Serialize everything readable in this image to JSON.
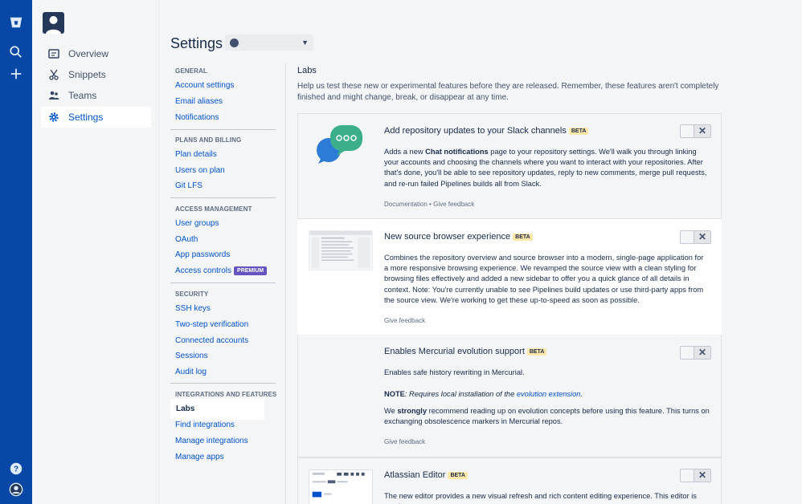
{
  "global_nav": {
    "icons": [
      "bitbucket-logo-icon",
      "search-icon",
      "plus-icon",
      "help-icon",
      "user-avatar-icon"
    ]
  },
  "container_nav": {
    "items": [
      {
        "label": "Overview",
        "icon": "overview-icon"
      },
      {
        "label": "Snippets",
        "icon": "scissors-icon"
      },
      {
        "label": "Teams",
        "icon": "people-icon"
      },
      {
        "label": "Settings",
        "icon": "gear-icon",
        "active": true
      }
    ]
  },
  "header": {
    "title": "Settings",
    "account_select": ""
  },
  "settings_nav": {
    "general": {
      "heading": "GENERAL",
      "links": [
        "Account settings",
        "Email aliases",
        "Notifications"
      ]
    },
    "plans": {
      "heading": "PLANS AND BILLING",
      "links": [
        "Plan details",
        "Users on plan",
        "Git LFS"
      ]
    },
    "access": {
      "heading": "ACCESS MANAGEMENT",
      "links": [
        "User groups",
        "OAuth",
        "App passwords",
        "Access controls"
      ],
      "premium_badge": "PREMIUM"
    },
    "security": {
      "heading": "SECURITY",
      "links": [
        "SSH keys",
        "Two-step verification",
        "Connected accounts",
        "Sessions",
        "Audit log"
      ]
    },
    "integrations": {
      "heading": "INTEGRATIONS AND FEATURES",
      "active": "Labs",
      "links": [
        "Find integrations",
        "Manage integrations",
        "Manage apps"
      ]
    }
  },
  "labs": {
    "title": "Labs",
    "intro": "Help us test these new or experimental features before they are released. Remember, these features aren't completely finished and might change, break, or disappear at any time.",
    "beta_label": "BETA",
    "features": [
      {
        "title": "Add repository updates to your Slack channels",
        "desc_pre": "Adds a new ",
        "desc_bold": "Chat notifications",
        "desc_post": " page to your repository settings. We'll walk you through linking your accounts and choosing the channels where you want to interact with your repositories. After that's done, you'll be able to see repository updates, reply to new comments, merge pull requests, and re-run failed Pipelines builds all from Slack.",
        "meta_doc": "Documentation",
        "meta_sep": "•",
        "meta_feedback": "Give feedback",
        "enabled": false
      },
      {
        "title": "New source browser experience",
        "desc": "Combines the repository overview and source browser into a modern, single-page application for a more responsive browsing experience. We revamped the source view with a clean styling for browsing files effectively and added a new sidebar to offer you a quick glance of all details in context. Note: You're currently unable to see Pipelines build updates or use third-party apps from the source view. We're working to get these up-to-speed as soon as possible.",
        "meta_feedback": "Give feedback",
        "enabled": false
      },
      {
        "title": "Enables Mercurial evolution support",
        "desc1": "Enables safe history rewriting in Mercurial.",
        "note_label": "NOTE",
        "note_pre": ": Requires local installation of the ",
        "note_link": "evolution extension",
        "note_post": ".",
        "desc3_pre": "We ",
        "desc3_bold": "strongly",
        "desc3_post": " recommend reading up on evolution concepts before using this feature. This turns on exchanging obsolescence markers in Mercurial repos.",
        "meta_feedback": "Give feedback",
        "enabled": false
      },
      {
        "title": "Atlassian Editor",
        "desc": "The new editor provides a new visual refresh and rich content editing experience. This editor is used",
        "enabled": false
      }
    ],
    "toggle_off_glyph": "✕"
  },
  "colors": {
    "global_nav": "#0747a6",
    "link": "#0052cc",
    "beta_badge": "#ffe7a8",
    "premium_badge": "#6554c0",
    "slack_green": "#3cae8c",
    "slack_blue": "#2c7bd6"
  }
}
